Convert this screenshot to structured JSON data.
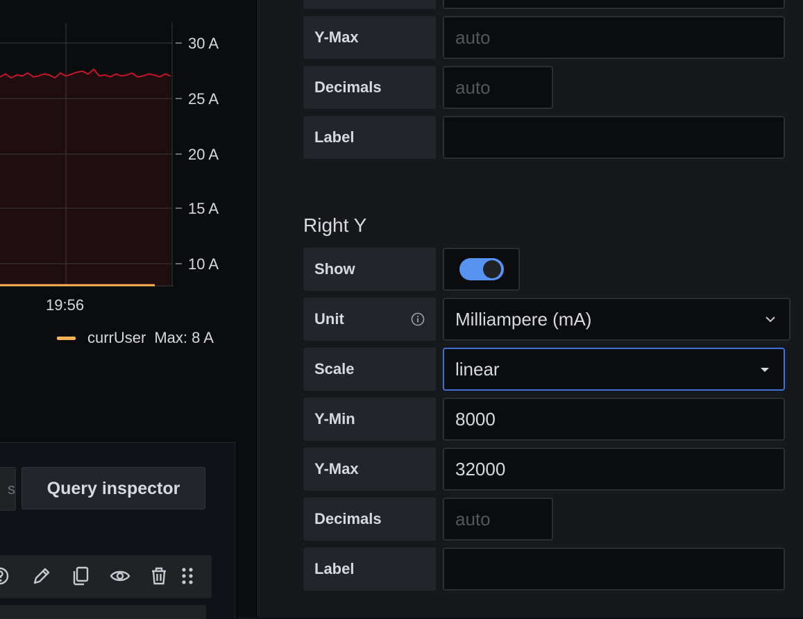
{
  "graph": {
    "y_ticks": [
      "30 A",
      "25 A",
      "20 A",
      "15 A",
      "10 A"
    ],
    "x_tick": "19:56",
    "legend": {
      "series": "currUser",
      "max": "Max: 8 A",
      "color": "#ffb357"
    },
    "line_color": "#c4162a",
    "fill_color": "#1f0d10"
  },
  "query_panel": {
    "tab_stub": "s",
    "query_inspector_label": "Query inspector",
    "toolbar_icons": [
      "help-icon",
      "edit-icon",
      "copy-icon",
      "eye-icon",
      "trash-icon",
      "drag-handle-icon"
    ]
  },
  "left_y": {
    "y_max": {
      "label": "Y-Max",
      "placeholder": "auto"
    },
    "decimals": {
      "label": "Decimals",
      "placeholder": "auto"
    },
    "label": {
      "label": "Label",
      "value": ""
    }
  },
  "right_y": {
    "title": "Right Y",
    "show": {
      "label": "Show",
      "enabled": true
    },
    "unit": {
      "label": "Unit",
      "value": "Milliampere (mA)"
    },
    "scale": {
      "label": "Scale",
      "value": "linear"
    },
    "y_min": {
      "label": "Y-Min",
      "value": "8000"
    },
    "y_max": {
      "label": "Y-Max",
      "value": "32000"
    },
    "decimals": {
      "label": "Decimals",
      "placeholder": "auto"
    },
    "label": {
      "label": "Label",
      "value": ""
    }
  },
  "colors": {
    "accent": "#5794f2",
    "focus_border": "#3d71d9"
  }
}
